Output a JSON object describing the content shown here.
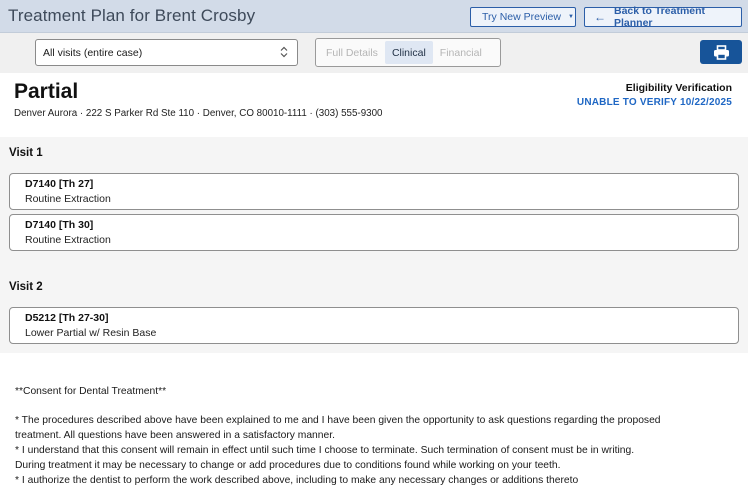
{
  "header": {
    "title": "Treatment Plan for Brent Crosby",
    "preview_label": "Try New Preview",
    "back_label": "Back to Treatment Planner"
  },
  "toolbar": {
    "visit_select": "All visits (entire case)",
    "segments": [
      "Full Details",
      "Clinical",
      "Financial"
    ],
    "active_segment": "Clinical",
    "print_icon": "printer-icon"
  },
  "plan": {
    "name": "Partial",
    "address": "Denver Aurora · 222 S Parker Rd Ste 110 · Denver, CO 80010-1111 · (303) 555-9300",
    "eligibility_title": "Eligibility Verification",
    "eligibility_status": "UNABLE TO VERIFY 10/22/2025"
  },
  "visits": [
    {
      "title": "Visit 1",
      "procedures": [
        {
          "code": "D7140 [Th 27]",
          "description": "Routine Extraction"
        },
        {
          "code": "D7140 [Th 30]",
          "description": "Routine Extraction"
        }
      ]
    },
    {
      "title": "Visit 2",
      "procedures": [
        {
          "code": "D5212 [Th 27-30]",
          "description": "Lower Partial w/ Resin Base"
        }
      ]
    }
  ],
  "consent": {
    "heading": "**Consent for Dental Treatment**",
    "lines": [
      "* The procedures described above have been explained to me and I have been given the opportunity to ask questions regarding the proposed",
      "treatment. All questions have been answered in a satisfactory manner.",
      "* I understand that this consent will remain in effect until such time I choose to terminate. Such termination of consent must be in writing.",
      "During treatment it may be necessary to change or add procedures due to conditions found while working on your teeth.",
      "* I authorize the dentist to perform the work described above, including to make any necessary changes or additions thereto"
    ]
  },
  "colors": {
    "header_bg": "#d2dbe8",
    "accent": "#175499",
    "eligibility": "#1f67c4"
  }
}
